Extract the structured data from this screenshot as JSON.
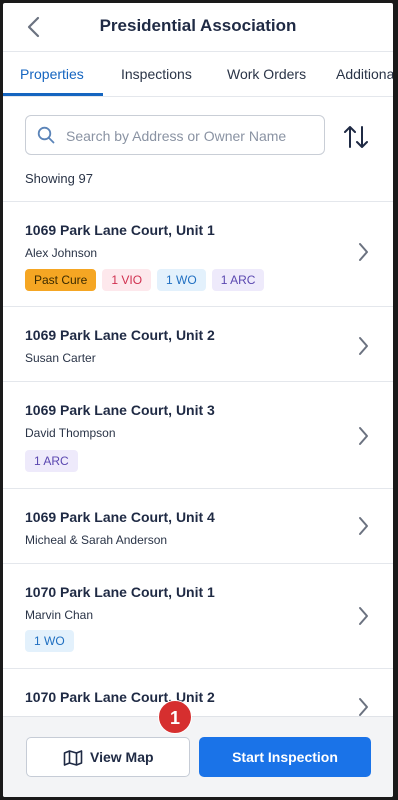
{
  "header": {
    "title": "Presidential Association",
    "back_icon": "chevron-left-icon"
  },
  "tabs": [
    {
      "label": "Properties",
      "active": true
    },
    {
      "label": "Inspections",
      "active": false
    },
    {
      "label": "Work Orders",
      "active": false
    },
    {
      "label": "Additional",
      "active": false
    }
  ],
  "search": {
    "placeholder": "Search by Address or Owner Name",
    "value": "",
    "icon": "search-icon"
  },
  "sort_icon": "sort-icon",
  "showing": "Showing 97",
  "properties": [
    {
      "address": "1069 Park Lane Court, Unit 1",
      "owner": "Alex Johnson",
      "badges": [
        "Past Cure",
        "1 VIO",
        "1 WO",
        "1 ARC"
      ]
    },
    {
      "address": "1069 Park Lane Court, Unit 2",
      "owner": "Susan Carter",
      "badges": []
    },
    {
      "address": "1069 Park Lane Court, Unit 3",
      "owner": "David Thompson",
      "badges": [
        "1 ARC"
      ]
    },
    {
      "address": "1069 Park Lane Court, Unit 4",
      "owner": "Micheal & Sarah Anderson",
      "badges": []
    },
    {
      "address": "1070 Park Lane Court, Unit 1",
      "owner": "Marvin Chan",
      "badges": [
        "1 WO"
      ]
    },
    {
      "address": "1070 Park Lane Court, Unit 2",
      "owner": "",
      "badges": []
    }
  ],
  "bottom": {
    "view_map_label": "View Map",
    "view_map_icon": "map-icon",
    "start_inspection_label": "Start Inspection",
    "notification_count": "1"
  },
  "colors": {
    "accent": "#1a73e8",
    "past_cure": "#f5a623",
    "vio": "#d0304f",
    "wo": "#1f6fc1",
    "arc": "#5a47b0",
    "notification": "#d62f2f"
  }
}
